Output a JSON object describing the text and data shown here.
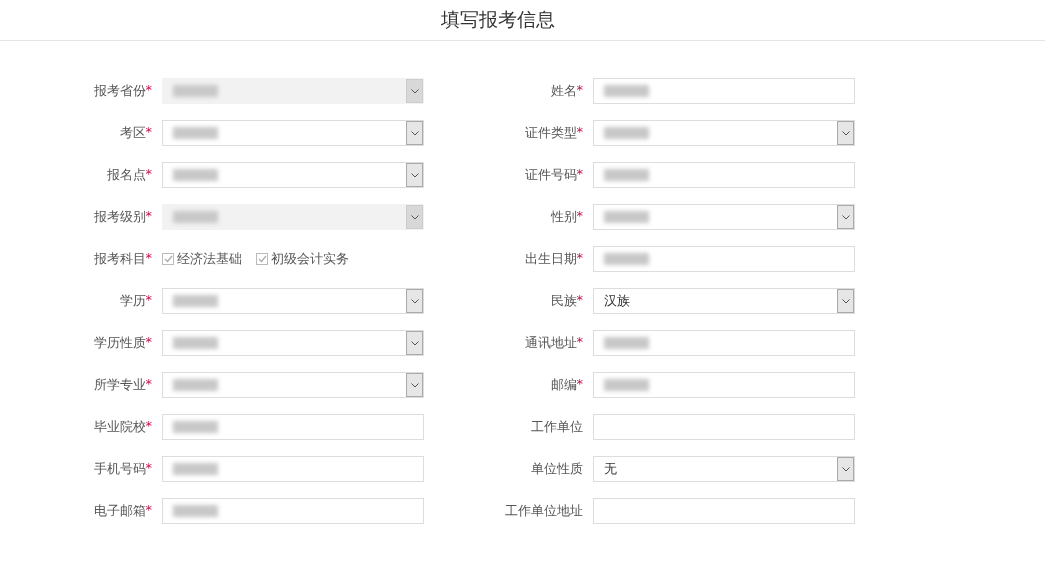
{
  "title": "填写报考信息",
  "columns": [
    {
      "fields": [
        {
          "label": "报考省份",
          "mark": "*",
          "kind": "select",
          "disabled": true,
          "redacted": true
        },
        {
          "label": "考区",
          "mark": "*",
          "kind": "select",
          "disabled": false,
          "redacted": true
        },
        {
          "label": "报名点",
          "mark": "*",
          "kind": "select",
          "disabled": false,
          "redacted": true
        },
        {
          "label": "报考级别",
          "mark": "*",
          "kind": "select",
          "disabled": true,
          "redacted": true
        },
        {
          "label": "报考科目",
          "mark": "*",
          "kind": "checkboxes",
          "options": [
            {
              "label": "经济法基础",
              "checked": true
            },
            {
              "label": "初级会计实务",
              "checked": true
            }
          ]
        },
        {
          "label": "学历",
          "mark": "*",
          "kind": "select",
          "disabled": false,
          "redacted": true
        },
        {
          "label": "学历性质",
          "mark": "*",
          "kind": "select",
          "disabled": false,
          "redacted": true
        },
        {
          "label": "所学专业",
          "mark": "*",
          "kind": "select",
          "disabled": false,
          "redacted": true
        },
        {
          "label": "毕业院校",
          "mark": "*",
          "kind": "text",
          "disabled": false,
          "redacted": true
        },
        {
          "label": "手机号码",
          "mark": "*",
          "kind": "text",
          "disabled": false,
          "redacted": true
        },
        {
          "label": "电子邮箱",
          "mark": "*",
          "kind": "text",
          "disabled": false,
          "redacted": true
        }
      ]
    },
    {
      "fields": [
        {
          "label": "姓名",
          "mark": "*",
          "kind": "text",
          "disabled": false,
          "redacted": true
        },
        {
          "label": "证件类型",
          "mark": "*",
          "kind": "select",
          "disabled": false,
          "redacted": true
        },
        {
          "label": "证件号码",
          "mark": "*",
          "kind": "text",
          "disabled": false,
          "redacted": true
        },
        {
          "label": "性别",
          "mark": "*",
          "kind": "select",
          "disabled": false,
          "redacted": true
        },
        {
          "label": "出生日期",
          "mark": "*",
          "kind": "text",
          "disabled": false,
          "redacted": true
        },
        {
          "label": "民族",
          "mark": "*",
          "kind": "select",
          "disabled": false,
          "value": "汉族"
        },
        {
          "label": "通讯地址",
          "mark": "*",
          "kind": "text",
          "disabled": false,
          "redacted": true
        },
        {
          "label": "邮编",
          "mark": "*",
          "kind": "text",
          "disabled": false,
          "redacted": true
        },
        {
          "label": "工作单位",
          "kind": "text",
          "disabled": false
        },
        {
          "label": "单位性质",
          "kind": "select",
          "disabled": false,
          "value": "无"
        },
        {
          "label": "工作单位地址",
          "kind": "text",
          "disabled": false
        }
      ]
    }
  ]
}
